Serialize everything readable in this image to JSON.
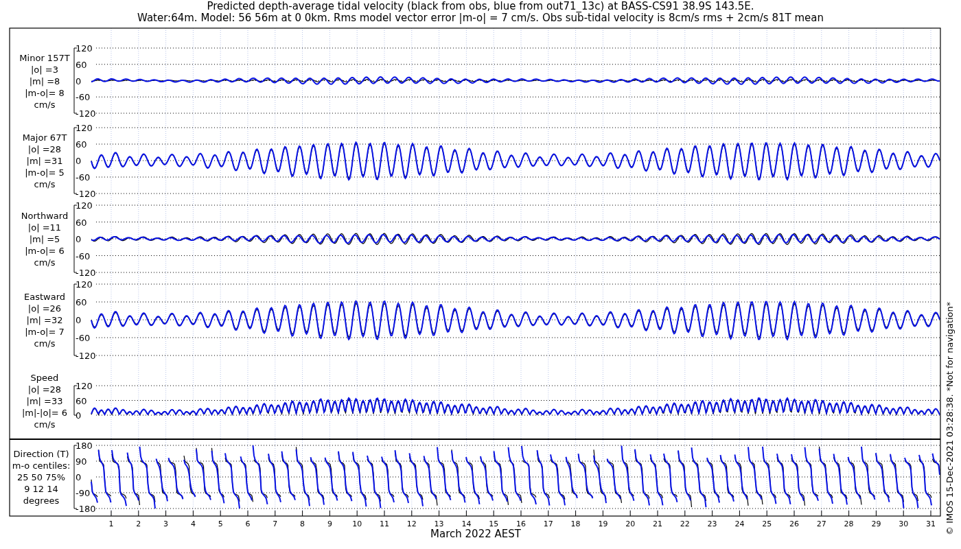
{
  "title": [
    "Predicted depth-average tidal velocity (black from obs, blue from out71_13c) at BASS-CS91 38.9S 143.5E.",
    "Water:64m. Model: 56 56m at 0 0km. Rms model vector error |m-o| = 7 cm/s. Obs sub-tidal velocity is 8cm/s rms + 2cm/s 81T mean"
  ],
  "panels": [
    {
      "kind": "minor",
      "label": [
        "Minor 157T",
        "|o| =3",
        "|m| =8",
        "|m-o|= 8",
        "cm/s"
      ],
      "yticks": [
        "120",
        "60",
        "0",
        "-60",
        "-120"
      ]
    },
    {
      "kind": "major",
      "label": [
        "Major 67T",
        "|o| =28",
        "|m| =31",
        "|m-o|= 5",
        "cm/s"
      ],
      "yticks": [
        "120",
        "60",
        "0",
        "-60",
        "-120"
      ]
    },
    {
      "kind": "north",
      "label": [
        "Northward",
        "|o| =11",
        "|m| =5",
        "|m-o|= 6",
        "cm/s"
      ],
      "yticks": [
        "120",
        "60",
        "0",
        "-60",
        "-120"
      ]
    },
    {
      "kind": "east",
      "label": [
        "Eastward",
        "|o| =26",
        "|m| =32",
        "|m-o|= 7",
        "cm/s"
      ],
      "yticks": [
        "120",
        "60",
        "0",
        "-60",
        "-120"
      ]
    },
    {
      "kind": "speed",
      "label": [
        "Speed",
        "|o| =28",
        "|m| =33",
        "|m|-|o|= 6",
        "cm/s"
      ],
      "yticks": [
        "120",
        "60",
        "0"
      ]
    },
    {
      "kind": "direction",
      "label": [
        "Direction (T)",
        "m-o centiles:",
        "25  50  75%",
        "9  12  14",
        "degrees"
      ],
      "yticks": [
        "180",
        "90",
        "0",
        "-90",
        "-180"
      ]
    }
  ],
  "xaxis": {
    "ticks": [
      "1",
      "2",
      "3",
      "4",
      "5",
      "6",
      "7",
      "8",
      "9",
      "10",
      "11",
      "12",
      "13",
      "14",
      "15",
      "16",
      "17",
      "18",
      "19",
      "20",
      "21",
      "22",
      "23",
      "24",
      "25",
      "26",
      "27",
      "28",
      "29",
      "30",
      "31"
    ],
    "label": "March 2022 AEST"
  },
  "credit": "© IMOS 15-Dec-2021 03:28:38.  *Not for navigation*"
}
